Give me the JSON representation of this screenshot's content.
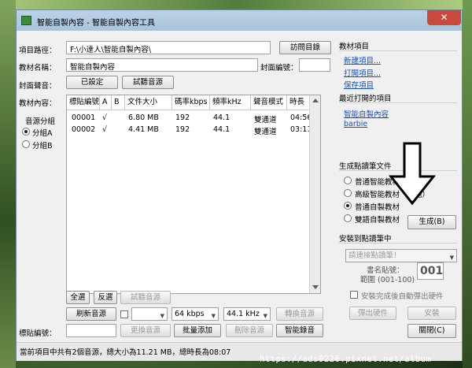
{
  "window": {
    "title": "智能自製內容 - 智能自製內容工具",
    "close_glyph": "✕"
  },
  "project": {
    "path_label": "項目路徑：",
    "path_value": "F:\\小達人\\智能自製內容\\",
    "browse_button": "訪問目錄",
    "name_label": "教材名稱：",
    "name_value": "智能自製內容",
    "cover_no_label": "封面編號：",
    "cover_no_value": "",
    "cover_sound_label": "封面聲音：",
    "cover_sound_set_button": "已設定",
    "cover_sound_test_button": "試聽音源",
    "content_label": "教材內容："
  },
  "audio_group": {
    "title": "音源分組",
    "options": [
      "分組A",
      "分組B"
    ],
    "selected": "分組A"
  },
  "table": {
    "columns": [
      "標貼編號",
      "A",
      "B",
      "文件大小",
      "碼率kbps",
      "頻率kHz",
      "聲音模式",
      "時長"
    ],
    "rows": [
      [
        "00001",
        "√",
        "",
        "6.80 MB",
        "192",
        "44.1",
        "雙通道",
        "04:56"
      ],
      [
        "00002",
        "√",
        "",
        "4.41 MB",
        "192",
        "44.1",
        "雙通道",
        "03:11"
      ]
    ]
  },
  "toolbar": {
    "select_all": "全選",
    "invert": "反選",
    "test_audio": "試聽音源",
    "refresh": "刷新音源",
    "bitrate": "64 kbps",
    "freq": "44.1 kHz",
    "convert": "轉換音源",
    "label_no_label": "標貼編號：",
    "label_no_value": "",
    "replace": "更換音源",
    "batch_add": "批量添加",
    "delete": "刪除音源",
    "smart_record": "智能錄音"
  },
  "sidebar": {
    "section_title": "教材項目",
    "items": [
      "新建項目...",
      "打開項目...",
      "保存項目"
    ],
    "recent_title": "最近打開的項目",
    "recent": [
      "智能自製內容",
      "barbie"
    ],
    "generate_title": "生成點讀筆文件",
    "generate_options": [
      "普通智能教材",
      "高級智能教材（雙語）",
      "普通自製教材",
      "雙語自製教材"
    ],
    "generate_selected": "普通自製教材",
    "generate_button": "生成(B)",
    "install_title": "安裝到點讀筆中",
    "pen_placeholder": "請連接點讀筆！",
    "storage_label": "書名貼號：",
    "range_label": "範圍 (001-100)",
    "storage_value": "001",
    "auto_eject_label": "安裝完成後自動彈出硬件",
    "eject_button": "彈出硬件",
    "install_button": "安裝",
    "close_button": "關閉(C)"
  },
  "status": {
    "text": "當前項目中共有2個音源，總大小為11.21 MB，總時長為08:07"
  },
  "watermark": "https://ads9226.pixnet.net/album"
}
